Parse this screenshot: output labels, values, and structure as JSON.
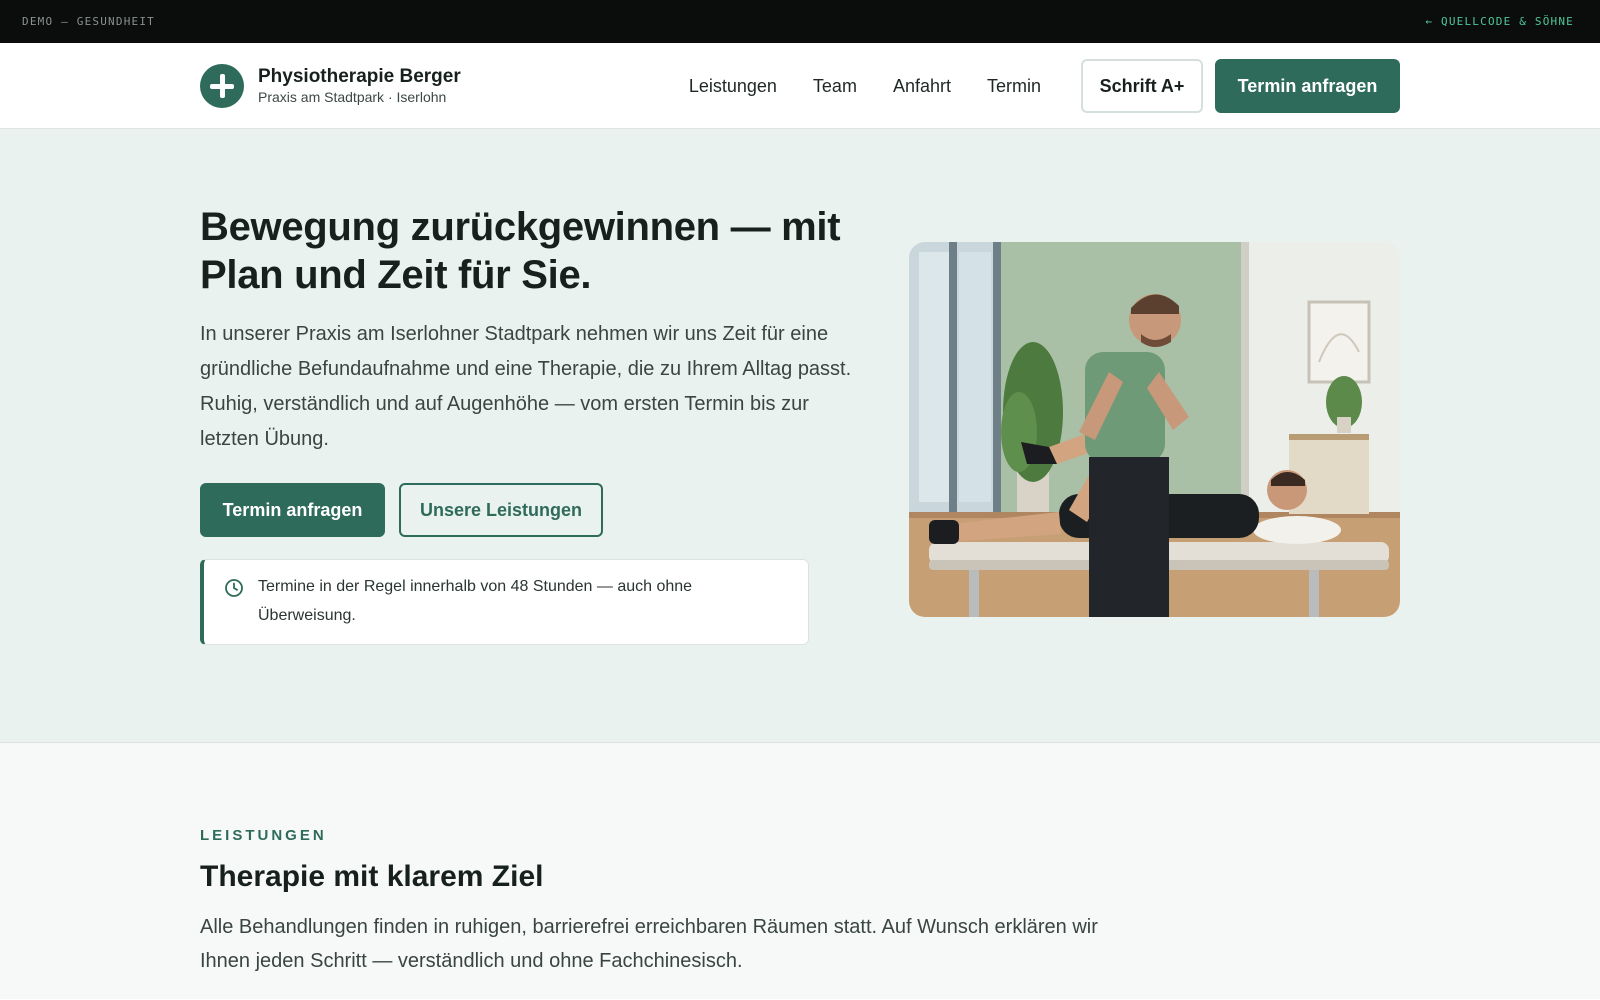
{
  "demo_bar": {
    "left_label": "DEMO — GESUNDHEIT",
    "right_link": "← QUELLCODE & SÖHNE"
  },
  "header": {
    "brand_name": "Physiotherapie Berger",
    "brand_subtitle": "Praxis am Stadtpark · Iserlohn",
    "logo_icon": "plus-cross-icon",
    "nav": [
      "Leistungen",
      "Team",
      "Anfahrt",
      "Termin"
    ],
    "font_size_button": "Schrift A+",
    "cta_button": "Termin anfragen"
  },
  "hero": {
    "title": "Bewegung zurückgewinnen — mit Plan und Zeit für Sie.",
    "lead": "In unserer Praxis am Iserlohner Stadtpark nehmen wir uns Zeit für eine gründliche Befundaufnahme und eine Therapie, die zu Ihrem Alltag passt. Ruhig, verständlich und auf Augenhöhe — vom ersten Termin bis zur letzten Übung.",
    "primary_button": "Termin anfragen",
    "secondary_button": "Unsere Leistungen",
    "notice_icon": "clock-icon",
    "notice_text": "Termine in der Regel innerhalb von 48 Stunden — auch ohne Überweisung."
  },
  "services": {
    "eyebrow": "LEISTUNGEN",
    "title": "Therapie mit klarem Ziel",
    "lead": "Alle Behandlungen finden in ruhigen, barrierefrei erreichbaren Räumen statt. Auf Wunsch erklären wir Ihnen jeden Schritt — verständlich und ohne Fachchinesisch."
  },
  "colors": {
    "primary": "#2f6b5a",
    "hero_background": "#eaf2ef",
    "demo_bar_background": "#0b0d0d",
    "demo_link": "#4fc69a"
  }
}
